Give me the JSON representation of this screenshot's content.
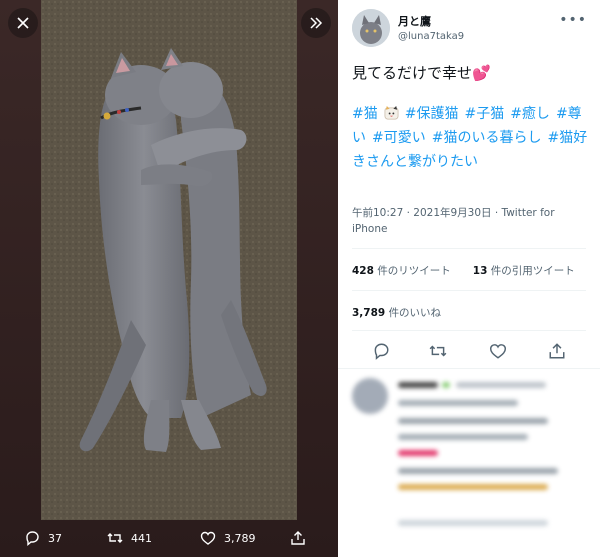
{
  "viewer": {
    "close_icon": "close-icon",
    "expand_icon": "expand-icon",
    "actions": [
      {
        "name": "reply",
        "icon": "reply-icon",
        "count": "37"
      },
      {
        "name": "retweet",
        "icon": "retweet-icon",
        "count": "441"
      },
      {
        "name": "like",
        "icon": "heart-icon",
        "count": "3,789"
      }
    ]
  },
  "tweet": {
    "display_name": "月と鷹",
    "handle": "@luna7taka9",
    "text": "見てるだけで幸せ",
    "text_emoji": "💕",
    "hashtags": [
      "#猫",
      "#保護猫",
      "#子猫",
      "#癒し",
      "#尊い",
      "#可愛い",
      "#猫のいる暮らし",
      "#猫好きさんと繋がりたい"
    ],
    "timestamp": "午前10:27 · 2021年9月30日 · Twitter for iPhone",
    "retweets_count": "428",
    "retweets_label": "件のリツイート",
    "quotes_count": "13",
    "quotes_label": "件の引用ツイート",
    "likes_count": "3,789",
    "likes_label": "件のいいね"
  },
  "colors": {
    "link": "#1d9bf0",
    "text": "#0f1419",
    "secondary": "#536471",
    "heart": "#e0245e"
  }
}
